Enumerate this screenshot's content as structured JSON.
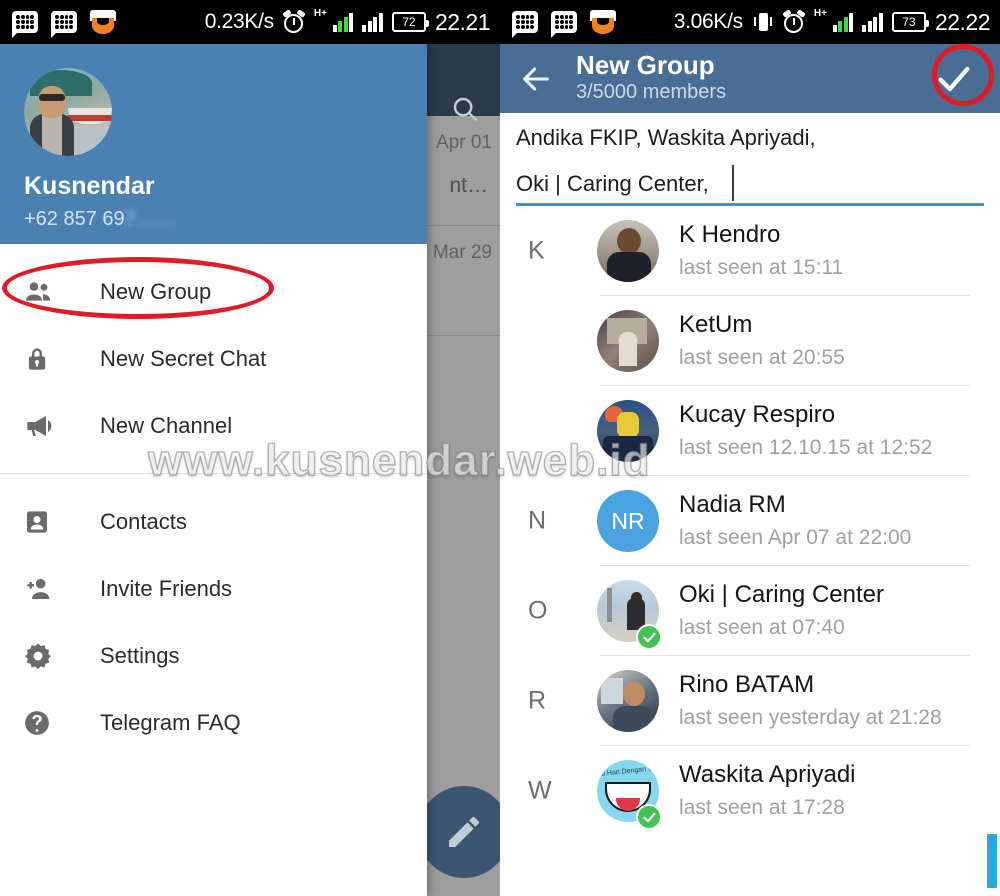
{
  "status_bar_left": {
    "icons": [
      "bbm-icon",
      "bbm-icon",
      "opera-mini-icon"
    ],
    "network_speed": "0.23K/s",
    "alarm_icon": "alarm-icon",
    "battery": "72",
    "time": "22.21"
  },
  "status_bar_right": {
    "icons": [
      "bbm-icon",
      "bbm-icon",
      "opera-mini-icon"
    ],
    "network_speed": "3.06K/s",
    "vibrate_icon": "vibrate-icon",
    "alarm_icon": "alarm-icon",
    "battery": "73",
    "time": "22.22"
  },
  "left_panel": {
    "background_chatlist": {
      "search_icon": "search-icon",
      "rows": [
        {
          "date": "Apr 01",
          "snippet": "nt…"
        },
        {
          "date": "Mar 29",
          "snippet": ""
        }
      ],
      "fab_icon": "pencil-icon"
    },
    "drawer": {
      "profile": {
        "avatar": "user-avatar",
        "name": "Kusnendar",
        "phone_prefix": "+62 857 69",
        "phone_blurred": "7……"
      },
      "menu_group_1": [
        {
          "icon": "group-icon",
          "label": "New Group"
        },
        {
          "icon": "lock-icon",
          "label": "New Secret Chat"
        },
        {
          "icon": "megaphone-icon",
          "label": "New Channel"
        }
      ],
      "menu_group_2": [
        {
          "icon": "contact-card-icon",
          "label": "Contacts"
        },
        {
          "icon": "person-add-icon",
          "label": "Invite Friends"
        },
        {
          "icon": "gear-icon",
          "label": "Settings"
        },
        {
          "icon": "help-circle-icon",
          "label": "Telegram FAQ"
        }
      ]
    }
  },
  "right_panel": {
    "header": {
      "back_icon": "arrow-left-icon",
      "title": "New Group",
      "subtitle": "3/5000 members",
      "confirm_icon": "check-icon"
    },
    "member_input": {
      "line1": "Andika FKIP, Waskita Apriyadi,",
      "line2": "Oki | Caring Center,"
    },
    "contacts": [
      {
        "index": "K",
        "avatar": "a-hendro",
        "name": "K Hendro",
        "last_seen": "last seen at 15:11",
        "selected": false
      },
      {
        "index": "",
        "avatar": "a-ketum",
        "name": "KetUm",
        "last_seen": "last seen at 20:55",
        "selected": false
      },
      {
        "index": "",
        "avatar": "a-kucay",
        "name": "Kucay Respiro",
        "last_seen": "last seen 12.10.15 at 12:52",
        "selected": false
      },
      {
        "index": "N",
        "avatar": "initials",
        "initials": "NR",
        "avatar_color": "#4aa3e0",
        "name": "Nadia RM",
        "last_seen": "last seen Apr 07 at 22:00",
        "selected": false
      },
      {
        "index": "O",
        "avatar": "a-oki",
        "name": "Oki | Caring Center",
        "last_seen": "last seen at 07:40",
        "selected": true
      },
      {
        "index": "R",
        "avatar": "a-rino",
        "name": "Rino BATAM",
        "last_seen": "last seen yesterday at 21:28",
        "selected": false
      },
      {
        "index": "W",
        "avatar": "a-waskita",
        "name": "Waskita Apriyadi",
        "last_seen": "last seen at 17:28",
        "selected": true
      }
    ]
  },
  "watermark": "www.kusnendar.web.id",
  "colors": {
    "drawer_header_blue": "#4b80b3",
    "right_header_blue": "#4a6d96",
    "accent_underline": "#2f9ad6",
    "selected_badge_green": "#41c451",
    "annotation_red": "#e01b24",
    "scrollbar_blue": "#29a8e0"
  }
}
